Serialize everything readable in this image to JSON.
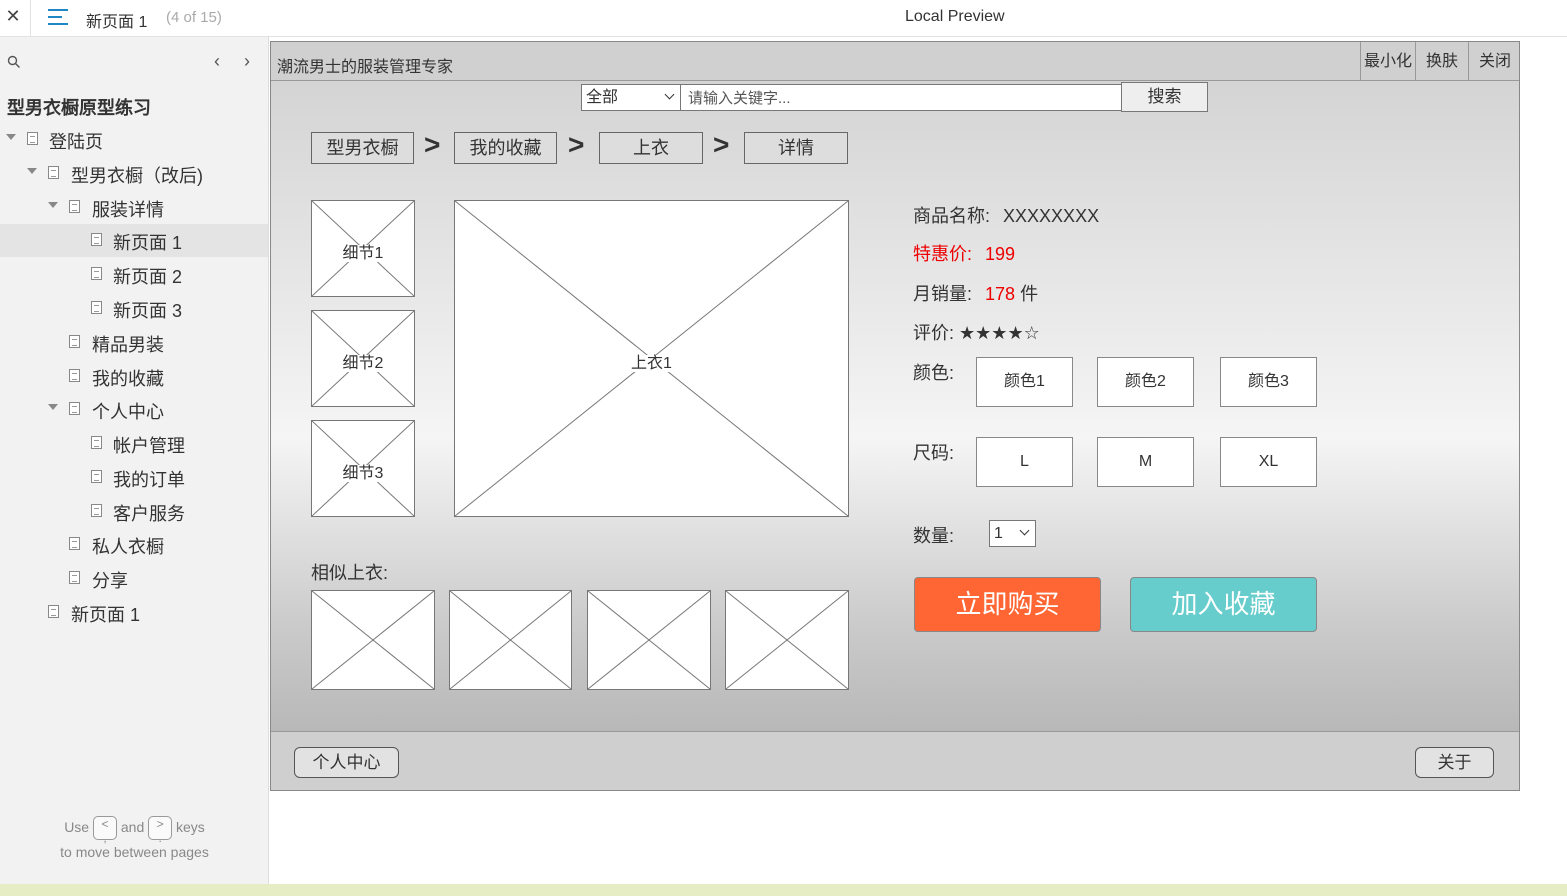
{
  "topbar": {
    "page_name": "新页面 1",
    "page_count": "(4 of 15)",
    "preview_title": "Local Preview"
  },
  "sidebar": {
    "project_title": "型男衣橱原型练习",
    "items": [
      {
        "label": "登陆页"
      },
      {
        "label": "型男衣橱（改后)"
      },
      {
        "label": "服装详情"
      },
      {
        "label": "新页面 1"
      },
      {
        "label": "新页面 2"
      },
      {
        "label": "新页面 3"
      },
      {
        "label": "精品男装"
      },
      {
        "label": "我的收藏"
      },
      {
        "label": "个人中心"
      },
      {
        "label": "帐户管理"
      },
      {
        "label": "我的订单"
      },
      {
        "label": "客户服务"
      },
      {
        "label": "私人衣橱"
      },
      {
        "label": "分享"
      },
      {
        "label": "新页面 1"
      }
    ],
    "help_use": "Use",
    "help_and": "and",
    "help_keys": "keys",
    "help_line2": "to move between pages"
  },
  "app": {
    "title": "潮流男士的服装管理专家",
    "window_buttons": [
      "最小化",
      "换肤",
      "关闭"
    ],
    "search": {
      "category": "全部",
      "placeholder": "请输入关键字...",
      "button": "搜索"
    },
    "breadcrumb": [
      "型男衣橱",
      "我的收藏",
      "上衣",
      "详情"
    ],
    "breadcrumb_sep": ">",
    "thumbnails": [
      "细节1",
      "细节2",
      "细节3"
    ],
    "main_image": "上衣1",
    "similar_label": "相似上衣:",
    "product": {
      "name_label": "商品名称:",
      "name_value": "XXXXXXXX",
      "price_label": "特惠价:",
      "price_value": "199",
      "sales_label": "月销量:",
      "sales_value": "178",
      "sales_unit": "件",
      "rating_label": "评价:",
      "rating_stars": "★★★★☆",
      "rating_value": 4,
      "color_label": "颜色:",
      "colors": [
        "颜色1",
        "颜色2",
        "颜色3"
      ],
      "size_label": "尺码:",
      "sizes": [
        "L",
        "M",
        "XL"
      ],
      "qty_label": "数量:",
      "qty_value": "1"
    },
    "buy_button": "立即购买",
    "fav_button": "加入收藏",
    "colors": {
      "buy": "#ff6633",
      "fav": "#66cccc",
      "price": "#ee0000"
    },
    "footer": {
      "left_button": "个人中心",
      "right_button": "关于"
    }
  }
}
